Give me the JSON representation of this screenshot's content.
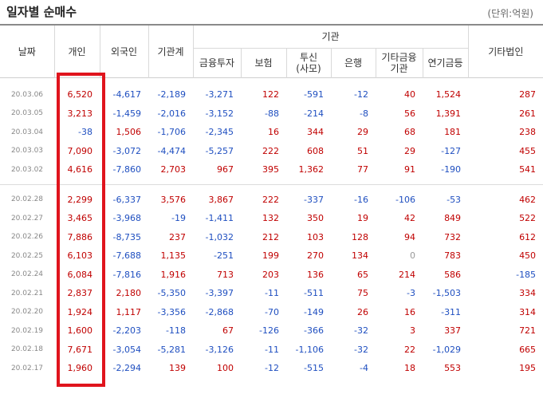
{
  "title": "일자별 순매수",
  "unit": "(단위:억원)",
  "headers": {
    "date": "날짜",
    "individual": "개인",
    "foreign": "외국인",
    "institution_total": "기관계",
    "institution_group": "기관",
    "finance_invest": "금융투자",
    "insurance": "보험",
    "trust": "투신",
    "trust_sub": "(사모)",
    "bank": "은행",
    "other_finance": "기타금융",
    "other_finance_sub": "기관",
    "pension": "연기금등",
    "other_corp": "기타법인"
  },
  "group1": [
    {
      "date": "20.03.06",
      "individual": "6,520",
      "foreign": "-4,617",
      "inst": "-2,189",
      "fin": "-3,271",
      "ins": "122",
      "trust": "-591",
      "bank": "-12",
      "etc": "40",
      "pension": "1,524",
      "corp": "287"
    },
    {
      "date": "20.03.05",
      "individual": "3,213",
      "foreign": "-1,459",
      "inst": "-2,016",
      "fin": "-3,152",
      "ins": "-88",
      "trust": "-214",
      "bank": "-8",
      "etc": "56",
      "pension": "1,391",
      "corp": "261"
    },
    {
      "date": "20.03.04",
      "individual": "-38",
      "foreign": "1,506",
      "inst": "-1,706",
      "fin": "-2,345",
      "ins": "16",
      "trust": "344",
      "bank": "29",
      "etc": "68",
      "pension": "181",
      "corp": "238"
    },
    {
      "date": "20.03.03",
      "individual": "7,090",
      "foreign": "-3,072",
      "inst": "-4,474",
      "fin": "-5,257",
      "ins": "222",
      "trust": "608",
      "bank": "51",
      "etc": "29",
      "pension": "-127",
      "corp": "455"
    },
    {
      "date": "20.03.02",
      "individual": "4,616",
      "foreign": "-7,860",
      "inst": "2,703",
      "fin": "967",
      "ins": "395",
      "trust": "1,362",
      "bank": "77",
      "etc": "91",
      "pension": "-190",
      "corp": "541"
    }
  ],
  "group2": [
    {
      "date": "20.02.28",
      "individual": "2,299",
      "foreign": "-6,337",
      "inst": "3,576",
      "fin": "3,867",
      "ins": "222",
      "trust": "-337",
      "bank": "-16",
      "etc": "-106",
      "pension": "-53",
      "corp": "462"
    },
    {
      "date": "20.02.27",
      "individual": "3,465",
      "foreign": "-3,968",
      "inst": "-19",
      "fin": "-1,411",
      "ins": "132",
      "trust": "350",
      "bank": "19",
      "etc": "42",
      "pension": "849",
      "corp": "522"
    },
    {
      "date": "20.02.26",
      "individual": "7,886",
      "foreign": "-8,735",
      "inst": "237",
      "fin": "-1,032",
      "ins": "212",
      "trust": "103",
      "bank": "128",
      "etc": "94",
      "pension": "732",
      "corp": "612"
    },
    {
      "date": "20.02.25",
      "individual": "6,103",
      "foreign": "-7,688",
      "inst": "1,135",
      "fin": "-251",
      "ins": "199",
      "trust": "270",
      "bank": "134",
      "etc": "0",
      "pension": "783",
      "corp": "450"
    },
    {
      "date": "20.02.24",
      "individual": "6,084",
      "foreign": "-7,816",
      "inst": "1,916",
      "fin": "713",
      "ins": "203",
      "trust": "136",
      "bank": "65",
      "etc": "214",
      "pension": "586",
      "corp": "-185"
    },
    {
      "date": "20.02.21",
      "individual": "2,837",
      "foreign": "2,180",
      "inst": "-5,350",
      "fin": "-3,397",
      "ins": "-11",
      "trust": "-511",
      "bank": "75",
      "etc": "-3",
      "pension": "-1,503",
      "corp": "334"
    },
    {
      "date": "20.02.20",
      "individual": "1,924",
      "foreign": "1,117",
      "inst": "-3,356",
      "fin": "-2,868",
      "ins": "-70",
      "trust": "-149",
      "bank": "26",
      "etc": "16",
      "pension": "-311",
      "corp": "314"
    },
    {
      "date": "20.02.19",
      "individual": "1,600",
      "foreign": "-2,203",
      "inst": "-118",
      "fin": "67",
      "ins": "-126",
      "trust": "-366",
      "bank": "-32",
      "etc": "3",
      "pension": "337",
      "corp": "721"
    },
    {
      "date": "20.02.18",
      "individual": "7,671",
      "foreign": "-3,054",
      "inst": "-5,281",
      "fin": "-3,126",
      "ins": "-11",
      "trust": "-1,106",
      "bank": "-32",
      "etc": "22",
      "pension": "-1,029",
      "corp": "665"
    },
    {
      "date": "20.02.17",
      "individual": "1,960",
      "foreign": "-2,294",
      "inst": "139",
      "fin": "100",
      "ins": "-12",
      "trust": "-515",
      "bank": "-4",
      "etc": "18",
      "pension": "553",
      "corp": "195"
    }
  ],
  "colors": {
    "positive": "#c00000",
    "negative": "#1f4fc0",
    "zero": "#999999",
    "highlight": "#e0141d"
  }
}
